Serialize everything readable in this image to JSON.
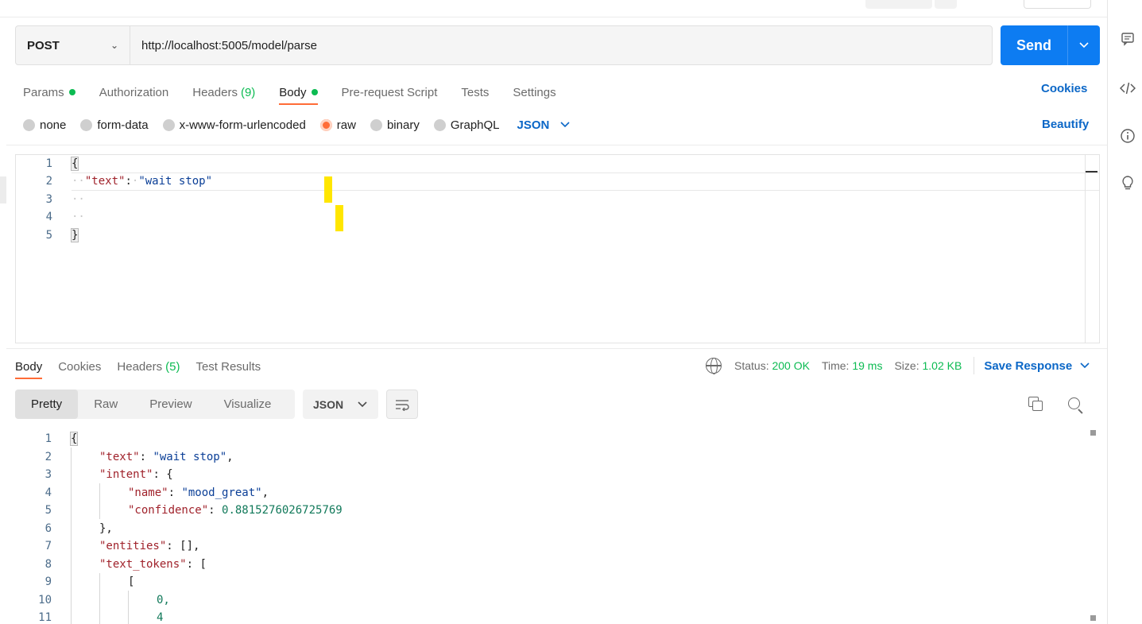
{
  "request": {
    "method": "POST",
    "url": "http://localhost:5005/model/parse",
    "send_label": "Send"
  },
  "request_tabs": [
    {
      "label": "Params",
      "dot": true
    },
    {
      "label": "Authorization"
    },
    {
      "label": "Headers",
      "count": "(9)"
    },
    {
      "label": "Body",
      "dot": true,
      "active": true
    },
    {
      "label": "Pre-request Script"
    },
    {
      "label": "Tests"
    },
    {
      "label": "Settings"
    }
  ],
  "cookies_label": "Cookies",
  "body_types": [
    {
      "label": "none"
    },
    {
      "label": "form-data"
    },
    {
      "label": "x-www-form-urlencoded"
    },
    {
      "label": "raw",
      "selected": true
    },
    {
      "label": "binary"
    },
    {
      "label": "GraphQL"
    }
  ],
  "body_language": "JSON",
  "beautify_label": "Beautify",
  "request_body": {
    "line_numbers": [
      "1",
      "2",
      "3",
      "4",
      "5"
    ],
    "open_brace": "{",
    "key": "\"text\"",
    "colon": ":",
    "value": "\"wait stop\"",
    "close_brace": "}"
  },
  "response_tabs": [
    {
      "label": "Body",
      "active": true
    },
    {
      "label": "Cookies"
    },
    {
      "label": "Headers",
      "count": "(5)"
    },
    {
      "label": "Test Results"
    }
  ],
  "response_meta": {
    "status_label": "Status:",
    "status_value": "200 OK",
    "time_label": "Time:",
    "time_value": "19 ms",
    "size_label": "Size:",
    "size_value": "1.02 KB",
    "save_label": "Save Response"
  },
  "response_views": [
    "Pretty",
    "Raw",
    "Preview",
    "Visualize"
  ],
  "response_language": "JSON",
  "response_body": {
    "line_numbers": [
      "1",
      "2",
      "3",
      "4",
      "5",
      "6",
      "7",
      "8",
      "9",
      "10",
      "11"
    ],
    "l1": "{",
    "l2_key": "\"text\"",
    "l2_val": "\"wait stop\"",
    "l3_key": "\"intent\"",
    "l3_rest": "{",
    "l4_key": "\"name\"",
    "l4_val": "\"mood_great\"",
    "l5_key": "\"confidence\"",
    "l5_val": "0.8815276026725769",
    "l6": "},",
    "l7_key": "\"entities\"",
    "l7_rest": "[],",
    "l8_key": "\"text_tokens\"",
    "l8_rest": "[",
    "l9": "[",
    "l10": "0,",
    "l11": "4"
  },
  "icons": {
    "comment": "comment-icon",
    "code": "code-icon",
    "info": "info-icon",
    "bulb": "lightbulb-icon"
  },
  "colors": {
    "accent": "#ff6c37",
    "send": "#0d7cf2",
    "link": "#0b67c7",
    "success": "#0cbb52"
  }
}
